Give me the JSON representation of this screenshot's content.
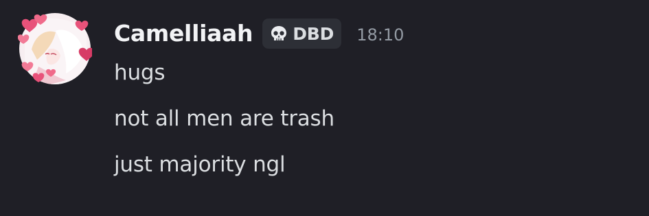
{
  "message": {
    "username": "Camelliaah",
    "tag": {
      "icon": "skull-icon",
      "label": "DBD"
    },
    "timestamp": "18:10",
    "lines": [
      "hugs",
      "not all men are trash",
      "just majority ngl"
    ]
  },
  "colors": {
    "background": "#1f1f26",
    "username": "#f2f3f5",
    "message_text": "#dbdee1",
    "timestamp": "#949ba4",
    "tag_background": "#2d2f36",
    "avatar_hearts": "#e8527a"
  }
}
